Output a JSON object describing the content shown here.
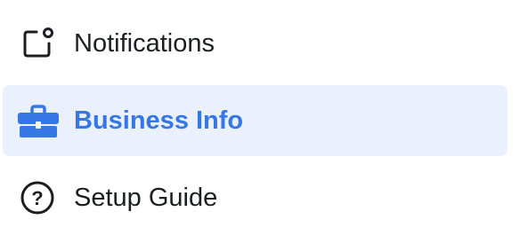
{
  "menu": {
    "items": [
      {
        "label": "Notifications",
        "icon": "notification-square-icon",
        "active": false
      },
      {
        "label": "Business Info",
        "icon": "briefcase-icon",
        "active": true
      },
      {
        "label": "Setup Guide",
        "icon": "question-circle-icon",
        "active": false
      }
    ]
  },
  "colors": {
    "active_background": "#eaf1fc",
    "active_text": "#3578e5",
    "text": "#1c1e21"
  }
}
